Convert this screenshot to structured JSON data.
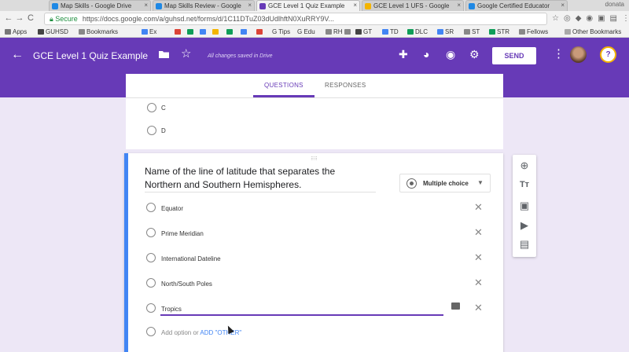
{
  "browser": {
    "tabs": [
      {
        "title": "Map Skills - Google Drive",
        "color": "#1e88e5"
      },
      {
        "title": "Map Skills Review - Google",
        "color": "#1e88e5"
      },
      {
        "title": "GCE Level 1 Quiz Example",
        "color": "#673ab7",
        "active": true
      },
      {
        "title": "GCE Level 1 UFS - Google",
        "color": "#f4b400"
      },
      {
        "title": "Google Certified Educator",
        "color": "#1e88e5"
      }
    ],
    "profile_label": "donata",
    "nav": {
      "back": "←",
      "forward": "→",
      "reload": "C",
      "home": "⌂"
    },
    "address": {
      "secure_label": "Secure",
      "url": "https://docs.google.com/a/guhsd.net/forms/d/1C11DTuZ03dUdlhftN0XuRRY9V..."
    },
    "bookmarks": [
      {
        "label": "Apps",
        "color": "#555"
      },
      {
        "label": "GUHSD",
        "color": "#444"
      },
      {
        "label": "Bookmarks",
        "color": "#555"
      },
      {
        "label": "Ex",
        "color": "#4285f4"
      },
      {
        "label": "",
        "color": "#db4437"
      },
      {
        "label": "",
        "color": "#0f9d58"
      },
      {
        "label": "",
        "color": "#4285f4"
      },
      {
        "label": "",
        "color": "#f4b400"
      },
      {
        "label": "G Tips",
        "color": "#4285f4"
      },
      {
        "label": "G Edu",
        "color": "#db4437"
      },
      {
        "label": "RH",
        "color": "#888"
      },
      {
        "label": "GT",
        "color": "#444"
      },
      {
        "label": "TD",
        "color": "#4285f4"
      },
      {
        "label": "DLC",
        "color": "#0f9d58"
      },
      {
        "label": "SR",
        "color": "#4285f4"
      },
      {
        "label": "ST",
        "color": "#888"
      },
      {
        "label": "STR",
        "color": "#0f9d58"
      },
      {
        "label": "Fellows",
        "color": "#888"
      },
      {
        "label": "Other Bookmarks",
        "color": "#888"
      }
    ]
  },
  "header": {
    "title": "GCE Level 1 Quiz Example",
    "saved_status": "All changes saved in Drive",
    "send_label": "SEND"
  },
  "form_tabs": {
    "questions": "QUESTIONS",
    "responses": "RESPONSES"
  },
  "previous_question": {
    "options": [
      "C",
      "D"
    ]
  },
  "question": {
    "line1": "Name of the line of latitude that separates the",
    "line2": "Northern and Southern Hemispheres.",
    "type": "Multiple choice",
    "options": [
      "Equator",
      "Prime Meridian",
      "International Dateline",
      "North/South Poles",
      "Tropics"
    ],
    "add_option": "Add option",
    "or": "or",
    "add_other": "ADD \"OTHER\""
  },
  "colors": {
    "brand": "#673ab7",
    "accent": "#4285f4",
    "background": "#ede7f6"
  }
}
